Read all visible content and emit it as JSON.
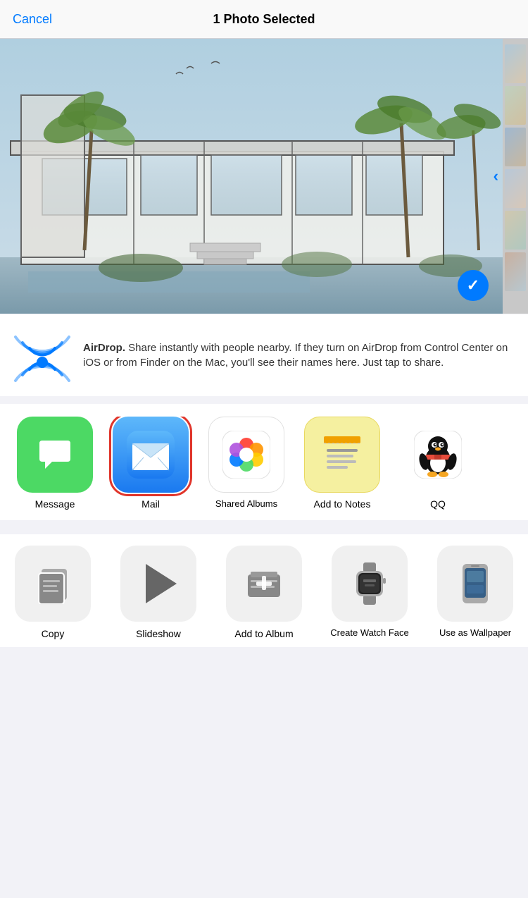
{
  "header": {
    "cancel_label": "Cancel",
    "title": "1 Photo Selected"
  },
  "airdrop": {
    "description": "AirDrop. Share instantly with people nearby. If they turn on AirDrop from Control Center on iOS or from Finder on the Mac, you'll see their names here. Just tap to share."
  },
  "apps": [
    {
      "id": "message",
      "label": "Message",
      "selected": false
    },
    {
      "id": "mail",
      "label": "Mail",
      "selected": true
    },
    {
      "id": "shared-albums",
      "label": "Shared Albums",
      "selected": false
    },
    {
      "id": "add-to-notes",
      "label": "Add to Notes",
      "selected": false
    },
    {
      "id": "qq",
      "label": "QQ",
      "selected": false
    }
  ],
  "actions": [
    {
      "id": "copy",
      "label": "Copy"
    },
    {
      "id": "slideshow",
      "label": "Slideshow"
    },
    {
      "id": "add-to-album",
      "label": "Add to Album"
    },
    {
      "id": "create-watch-face",
      "label": "Create Watch Face"
    },
    {
      "id": "use-as-wallpaper",
      "label": "Use as Wallpaper"
    }
  ]
}
